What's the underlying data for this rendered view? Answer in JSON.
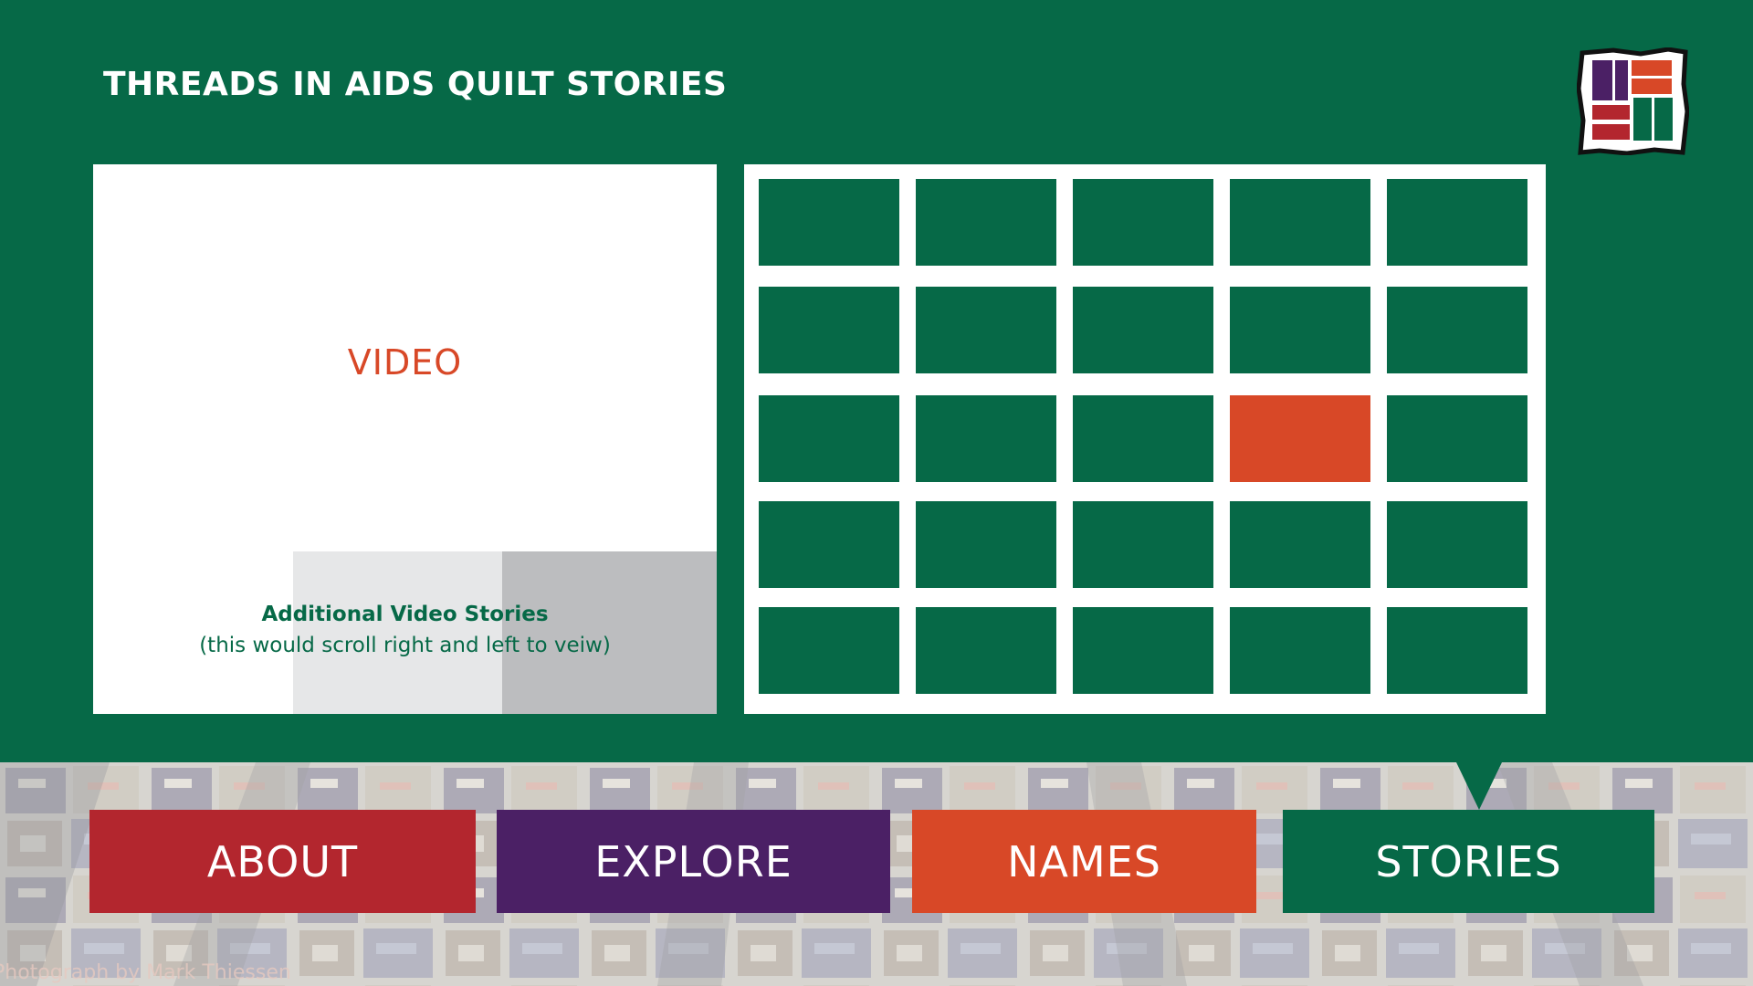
{
  "header": {
    "title": "THREADS IN AIDS QUILT STORIES"
  },
  "logo": {
    "icon": "quilt-logo-icon",
    "colors": [
      "#4b2065",
      "#d84827",
      "#b3262e",
      "#066947"
    ]
  },
  "video": {
    "label": "VIDEO",
    "additional_title": "Additional Video Stories",
    "additional_note": "(this would scroll right and left to veiw)"
  },
  "grid": {
    "rows": 5,
    "columns": 5,
    "selected": {
      "row": 3,
      "column": 4
    },
    "cell_color": "#066947",
    "selected_color": "#d84827"
  },
  "nav": {
    "about": "ABOUT",
    "explore": "EXPLORE",
    "names": "NAMES",
    "stories": "STORIES",
    "active": "STORIES"
  },
  "footer": {
    "credit": "Photograph by Mark Thiessen"
  },
  "colors": {
    "background": "#066947",
    "accent_red": "#b3262e",
    "accent_purple": "#4b2065",
    "accent_orange": "#d84827",
    "accent_green": "#066947"
  }
}
